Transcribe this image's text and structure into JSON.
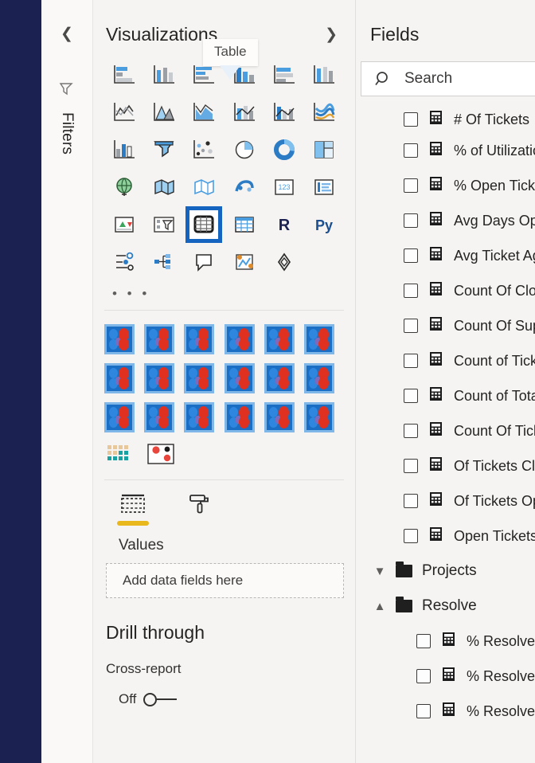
{
  "filters_rail": {
    "collapse_icon": "chevron-left-icon",
    "funnel_icon": "funnel-icon",
    "label": "Filters"
  },
  "visualizations": {
    "title": "Visualizations",
    "expand_icon": "chevron-right-icon",
    "more_label": "• • •",
    "tooltip": "Table",
    "icons": [
      "stacked-bar-chart-icon",
      "stacked-column-chart-icon",
      "clustered-bar-chart-icon",
      "clustered-column-chart-icon",
      "100-stacked-bar-chart-icon",
      "100-stacked-column-chart-icon",
      "line-chart-icon",
      "area-chart-icon",
      "stacked-area-chart-icon",
      "line-stacked-column-chart-icon",
      "line-clustered-column-chart-icon",
      "ribbon-chart-icon",
      "waterfall-chart-icon",
      "funnel-chart-icon",
      "scatter-chart-icon",
      "pie-chart-icon",
      "donut-chart-icon",
      "treemap-icon",
      "map-icon",
      "filled-map-icon",
      "shape-map-icon",
      "azure-map-icon",
      "gauge-icon",
      "card-icon",
      "multi-row-card-icon",
      "kpi-icon",
      "slicer-icon",
      "table-icon",
      "matrix-icon",
      "r-script-visual-icon",
      "python-visual-icon",
      "key-influencers-icon",
      "decomposition-tree-icon",
      "q-and-a-icon",
      "smart-narrative-icon",
      "paginated-report-icon"
    ],
    "selected_icon": "table-icon",
    "selected_index": 27,
    "custom_visuals_count": 18,
    "custom_visual_icon": "custom-visual-icon",
    "custom_extra": [
      "matrix-grid-icon",
      "bubble-cluster-icon"
    ],
    "tabs": [
      {
        "name": "fields-tab",
        "icon": "fields-grid-icon",
        "active": true
      },
      {
        "name": "format-tab",
        "icon": "paint-roller-icon",
        "active": false
      }
    ],
    "values_label": "Values",
    "dropzone_placeholder": "Add data fields here",
    "drill_through_title": "Drill through",
    "cross_report_label": "Cross-report",
    "cross_report_state": "Off",
    "accent_yellow": "#e8b81c",
    "selection_blue": "#1565c0"
  },
  "fields": {
    "title": "Fields",
    "search_icon": "search-icon",
    "search_placeholder": "Search",
    "measure_icon": "calculator-icon",
    "items": [
      {
        "label": "# Of Tickets",
        "checked": false
      },
      {
        "label": "% of Utilization",
        "checked": false
      },
      {
        "label": "% Open Tickets",
        "checked": false
      },
      {
        "label": "Avg Days Open",
        "checked": false
      },
      {
        "label": "Avg Ticket Age",
        "checked": false
      },
      {
        "label": "Count Of Closed",
        "checked": false
      },
      {
        "label": "Count Of Support",
        "checked": false
      },
      {
        "label": "Count of Tickets",
        "checked": false
      },
      {
        "label": "Count of Total",
        "checked": false
      },
      {
        "label": "Count Of Tickets",
        "checked": false
      },
      {
        "label": "Of Tickets Closed",
        "checked": false
      },
      {
        "label": "Of Tickets Open",
        "checked": false
      },
      {
        "label": "Open Tickets",
        "checked": false
      }
    ],
    "groups": [
      {
        "label": "Projects",
        "expanded": false,
        "chevron": "chevron-down-icon",
        "children": []
      },
      {
        "label": "Resolve",
        "expanded": true,
        "chevron": "chevron-up-icon",
        "children": [
          {
            "label": "% Resolved",
            "checked": false
          },
          {
            "label": "% Resolved SLA",
            "checked": false
          },
          {
            "label": "% Resolved Time",
            "checked": false
          }
        ]
      }
    ]
  }
}
